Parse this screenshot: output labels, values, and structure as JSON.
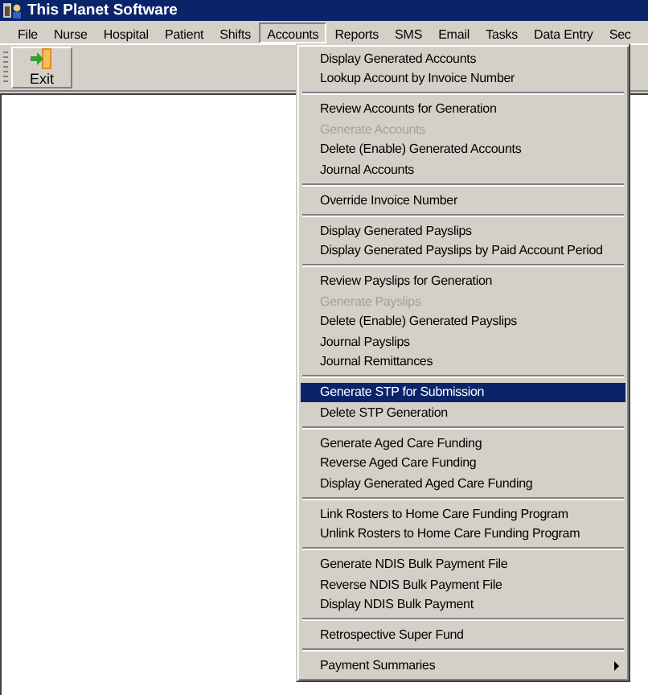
{
  "window": {
    "title": "This Planet Software"
  },
  "menubar": [
    {
      "label": "File",
      "selected": false
    },
    {
      "label": "Nurse",
      "selected": false
    },
    {
      "label": "Hospital",
      "selected": false
    },
    {
      "label": "Patient",
      "selected": false
    },
    {
      "label": "Shifts",
      "selected": false
    },
    {
      "label": "Accounts",
      "selected": true
    },
    {
      "label": "Reports",
      "selected": false
    },
    {
      "label": "SMS",
      "selected": false
    },
    {
      "label": "Email",
      "selected": false
    },
    {
      "label": "Tasks",
      "selected": false
    },
    {
      "label": "Data Entry",
      "selected": false
    },
    {
      "label": "Sec",
      "selected": false
    }
  ],
  "toolbar": {
    "buttons": [
      {
        "label": "Exit"
      }
    ]
  },
  "accounts_menu": {
    "groups": [
      {
        "items": [
          {
            "label": "Display Generated Accounts",
            "kind": "item",
            "disabled": false,
            "selected": false
          },
          {
            "label": "Lookup Account by Invoice Number",
            "kind": "item",
            "disabled": false,
            "selected": false
          }
        ]
      },
      {
        "items": [
          {
            "label": "Review Accounts for Generation",
            "kind": "item",
            "disabled": false,
            "selected": false
          },
          {
            "label": "Generate Accounts",
            "kind": "item",
            "disabled": true,
            "selected": false
          },
          {
            "label": "Delete (Enable) Generated Accounts",
            "kind": "item",
            "disabled": false,
            "selected": false
          },
          {
            "label": "Journal Accounts",
            "kind": "item",
            "disabled": false,
            "selected": false
          }
        ]
      },
      {
        "items": [
          {
            "label": "Override Invoice Number",
            "kind": "item",
            "disabled": false,
            "selected": false
          }
        ]
      },
      {
        "items": [
          {
            "label": "Display Generated Payslips",
            "kind": "item",
            "disabled": false,
            "selected": false
          },
          {
            "label": "Display Generated Payslips by Paid Account Period",
            "kind": "item",
            "disabled": false,
            "selected": false
          }
        ]
      },
      {
        "items": [
          {
            "label": "Review Payslips for Generation",
            "kind": "item",
            "disabled": false,
            "selected": false
          },
          {
            "label": "Generate Payslips",
            "kind": "item",
            "disabled": true,
            "selected": false
          },
          {
            "label": "Delete (Enable) Generated Payslips",
            "kind": "item",
            "disabled": false,
            "selected": false
          },
          {
            "label": "Journal Payslips",
            "kind": "item",
            "disabled": false,
            "selected": false
          },
          {
            "label": "Journal Remittances",
            "kind": "item",
            "disabled": false,
            "selected": false
          }
        ]
      },
      {
        "items": [
          {
            "label": "Generate STP for Submission",
            "kind": "item",
            "disabled": false,
            "selected": true
          },
          {
            "label": "Delete STP Generation",
            "kind": "item",
            "disabled": false,
            "selected": false
          }
        ]
      },
      {
        "items": [
          {
            "label": "Generate Aged Care Funding",
            "kind": "item",
            "disabled": false,
            "selected": false
          },
          {
            "label": "Reverse Aged Care Funding",
            "kind": "item",
            "disabled": false,
            "selected": false
          },
          {
            "label": "Display Generated Aged Care Funding",
            "kind": "item",
            "disabled": false,
            "selected": false
          }
        ]
      },
      {
        "items": [
          {
            "label": "Link Rosters to Home Care Funding Program",
            "kind": "item",
            "disabled": false,
            "selected": false
          },
          {
            "label": "Unlink Rosters to Home Care Funding Program",
            "kind": "item",
            "disabled": false,
            "selected": false
          }
        ]
      },
      {
        "items": [
          {
            "label": "Generate NDIS Bulk Payment File",
            "kind": "item",
            "disabled": false,
            "selected": false
          },
          {
            "label": "Reverse NDIS Bulk Payment File",
            "kind": "item",
            "disabled": false,
            "selected": false
          },
          {
            "label": "Display NDIS Bulk Payment",
            "kind": "item",
            "disabled": false,
            "selected": false
          }
        ]
      },
      {
        "items": [
          {
            "label": "Retrospective Super Fund",
            "kind": "item",
            "disabled": false,
            "selected": false
          }
        ]
      },
      {
        "items": [
          {
            "label": "Payment Summaries",
            "kind": "submenu",
            "disabled": false,
            "selected": false
          }
        ]
      }
    ]
  }
}
